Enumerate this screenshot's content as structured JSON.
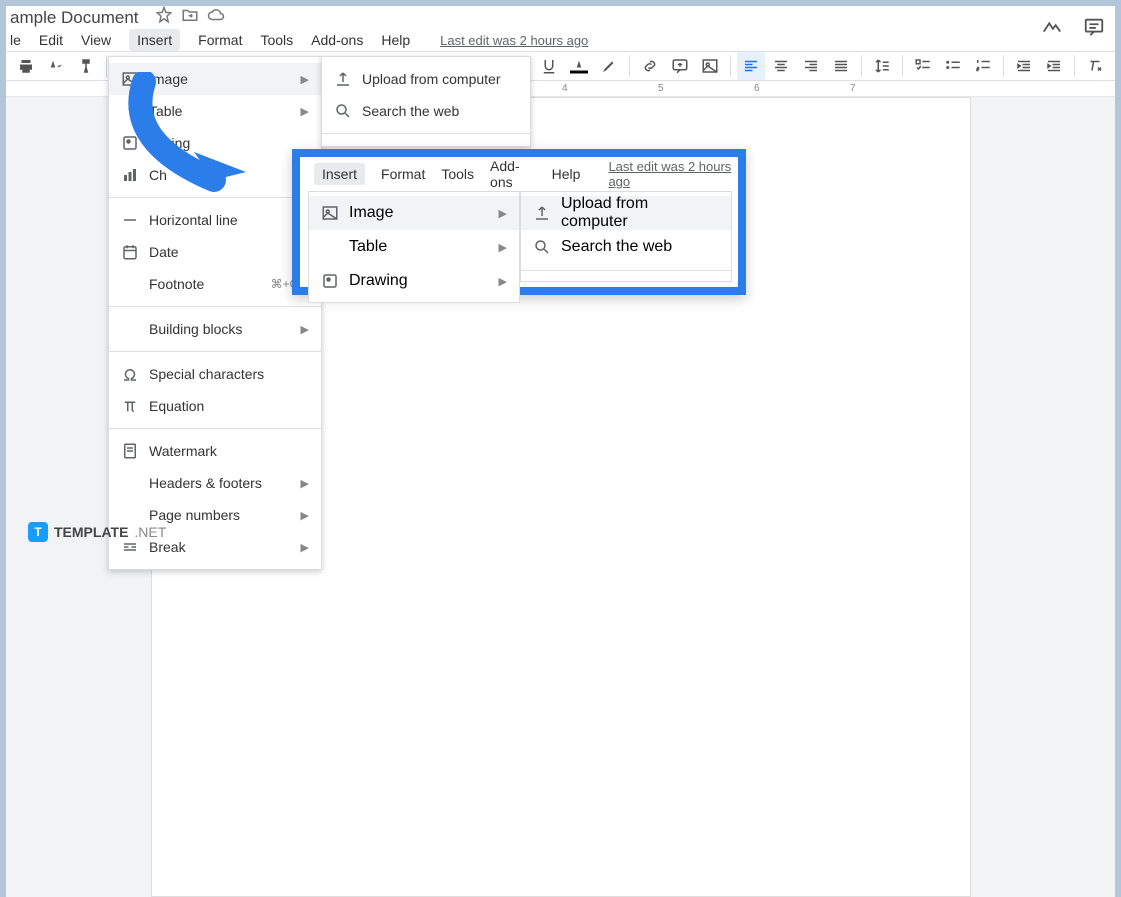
{
  "title": "ample Document",
  "menus": [
    "le",
    "Edit",
    "View",
    "Insert",
    "Format",
    "Tools",
    "Add-ons",
    "Help"
  ],
  "active_menu_index": 3,
  "last_edit": "Last edit was 2 hours ago",
  "ruler_marks": {
    "4": "4",
    "5": "5",
    "6": "6",
    "7": "7"
  },
  "insert_menu": [
    {
      "icon": "image",
      "label": "Image",
      "arrow": true,
      "hl": true
    },
    {
      "icon": "",
      "label": "Table",
      "arrow": true
    },
    {
      "icon": "drawing",
      "label": "rawing"
    },
    {
      "icon": "chart",
      "label": "Ch"
    },
    {
      "sep": true
    },
    {
      "icon": "hline",
      "label": "Horizontal line"
    },
    {
      "icon": "date",
      "label": "Date"
    },
    {
      "icon": "",
      "label": "Footnote",
      "shortcut": "⌘+Opt"
    },
    {
      "sep": true
    },
    {
      "icon": "",
      "label": "Building blocks",
      "arrow": true
    },
    {
      "sep": true
    },
    {
      "icon": "omega",
      "label": "Special characters"
    },
    {
      "icon": "pi",
      "label": "Equation"
    },
    {
      "sep": true
    },
    {
      "icon": "watermark",
      "label": "Watermark"
    },
    {
      "icon": "",
      "label": "Headers & footers",
      "arrow": true
    },
    {
      "icon": "",
      "label": "Page numbers",
      "arrow": true
    },
    {
      "icon": "break",
      "label": "Break",
      "arrow": true
    }
  ],
  "image_submenu": [
    {
      "icon": "upload",
      "label": "Upload from computer"
    },
    {
      "icon": "search",
      "label": "Search the web"
    }
  ],
  "callout": {
    "menus": [
      "Insert",
      "Format",
      "Tools",
      "Add-ons",
      "Help"
    ],
    "last_edit": "Last edit was 2 hours ago",
    "insert_items": [
      {
        "icon": "image",
        "label": "Image",
        "arrow": true,
        "hl": true
      },
      {
        "icon": "",
        "label": "Table",
        "arrow": true
      },
      {
        "icon": "drawing",
        "label": "Drawing",
        "arrow": true
      }
    ],
    "image_items": [
      {
        "icon": "upload",
        "label": "Upload from computer",
        "hl": true
      },
      {
        "icon": "search",
        "label": "Search the web"
      }
    ]
  },
  "brand": {
    "name": "TEMPLATE",
    "suffix": ".NET"
  }
}
